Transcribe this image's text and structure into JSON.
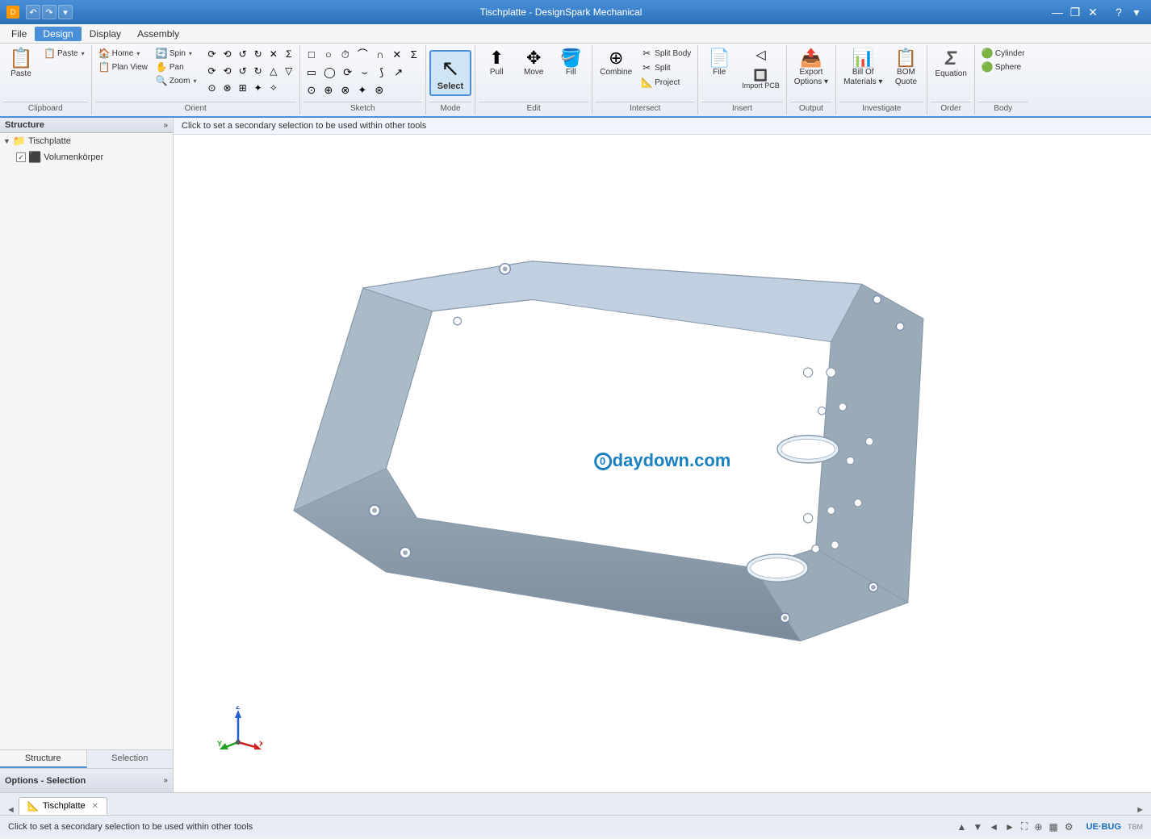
{
  "window": {
    "title": "Tischplatte - DesignSpark Mechanical",
    "controls": [
      "minimize",
      "restore",
      "close"
    ]
  },
  "titlebar": {
    "app_name": "DesignSpark Mechanical",
    "file_name": "Tischplatte",
    "title": "Tischplatte - DesignSpark Mechanical"
  },
  "menubar": {
    "items": [
      "File",
      "Design",
      "Display",
      "Assembly"
    ]
  },
  "ribbon": {
    "sections": [
      {
        "name": "Clipboard",
        "label": "Clipboard",
        "buttons": [
          {
            "id": "paste",
            "icon": "📋",
            "label": "Paste"
          }
        ]
      },
      {
        "name": "Orient",
        "label": "Orient",
        "groups": [
          {
            "icon": "🏠",
            "label": "Home",
            "hasArrow": true
          },
          {
            "icon": "🔄",
            "label": "Spin",
            "hasArrow": true
          },
          {
            "icon": "✋",
            "label": "Plan View"
          },
          {
            "icon": "↔",
            "label": "Pan"
          },
          {
            "icon": "🔍",
            "label": "Zoom",
            "hasArrow": true
          }
        ]
      },
      {
        "name": "Sketch",
        "label": "Sketch",
        "buttons": []
      },
      {
        "name": "Mode",
        "label": "Mode",
        "buttons": [
          {
            "id": "select",
            "label": "Select",
            "isActive": true
          }
        ]
      },
      {
        "name": "Edit",
        "label": "Edit",
        "buttons": [
          {
            "id": "pull",
            "icon": "⬆",
            "label": "Pull"
          },
          {
            "id": "move",
            "icon": "✥",
            "label": "Move"
          },
          {
            "id": "fill",
            "icon": "🪣",
            "label": "Fill"
          }
        ]
      },
      {
        "name": "Intersect",
        "label": "Intersect",
        "buttons": [
          {
            "id": "combine",
            "icon": "⊕",
            "label": "Combine"
          },
          {
            "id": "split-body",
            "icon": "✂",
            "label": "Split Body"
          },
          {
            "id": "split",
            "icon": "✂",
            "label": "Split"
          },
          {
            "id": "project",
            "icon": "📐",
            "label": "Project"
          }
        ]
      },
      {
        "name": "Insert",
        "label": "Insert",
        "buttons": [
          {
            "id": "file",
            "icon": "📄",
            "label": "File"
          },
          {
            "id": "import-pcb",
            "icon": "🔲",
            "label": "Import PCB"
          }
        ]
      },
      {
        "name": "Output",
        "label": "Output",
        "buttons": [
          {
            "id": "export-options",
            "icon": "📤",
            "label": "Export Options"
          }
        ]
      },
      {
        "name": "Investigate",
        "label": "Investigate",
        "buttons": [
          {
            "id": "bill-of-materials",
            "icon": "📊",
            "label": "Bill Of Materials"
          },
          {
            "id": "bom-quote",
            "icon": "📋",
            "label": "BOM Quote"
          }
        ]
      },
      {
        "name": "Order",
        "label": "Order",
        "buttons": [
          {
            "id": "equation",
            "icon": "Σ",
            "label": "Equation"
          }
        ]
      },
      {
        "name": "Body",
        "label": "Body",
        "buttons": [
          {
            "id": "cylinder",
            "icon": "⬤",
            "label": "Cylinder"
          },
          {
            "id": "sphere",
            "icon": "●",
            "label": "Sphere"
          }
        ]
      }
    ]
  },
  "sidebar": {
    "structure_label": "Structure",
    "collapse_btn": "»",
    "tree": {
      "root": {
        "name": "Tischplatte",
        "children": [
          {
            "name": "Volumenkörper",
            "hasCheckbox": true,
            "checked": true
          }
        ]
      }
    },
    "tabs": [
      {
        "id": "structure",
        "label": "Structure"
      },
      {
        "id": "selection",
        "label": "Selection"
      }
    ],
    "options_panel": {
      "label": "Options - Selection",
      "collapse_btn": "»"
    }
  },
  "viewport": {
    "hint": "Click to set a secondary selection to be used within other tools",
    "watermark": "0daydown.com",
    "model_description": "3D CAD table top plate"
  },
  "bottom": {
    "tabs": [
      {
        "id": "tischplatte",
        "label": "Tischplatte",
        "icon": "📐",
        "active": true
      }
    ],
    "nav_arrows": [
      "◄",
      "►"
    ]
  },
  "statusbar": {
    "hint": "Click to set a secondary selection to be used within other tools",
    "right_icons": [
      "▲",
      "▼",
      "◄",
      "►",
      "⛶",
      "⊕",
      "▦",
      "⚙"
    ]
  }
}
